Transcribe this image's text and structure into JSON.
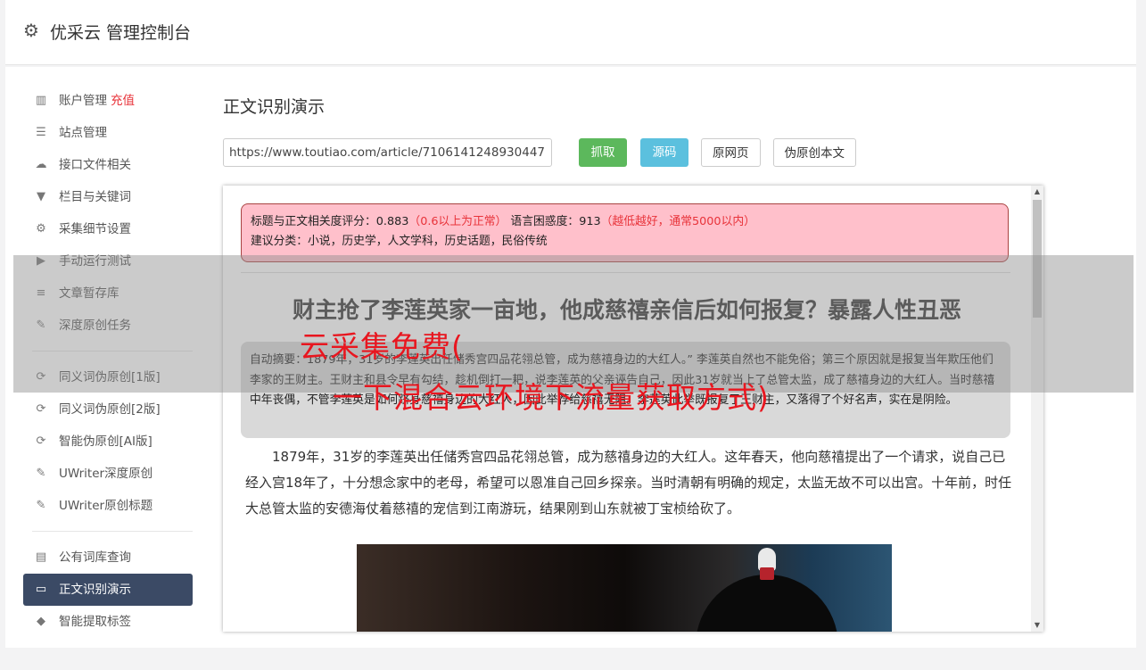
{
  "header": {
    "title": "优采云 管理控制台",
    "icon": "gear-icon"
  },
  "sidebar": {
    "group1": [
      {
        "label": "账户管理",
        "extra": "充值",
        "icon": "bar-chart-icon",
        "glyph": "▥"
      },
      {
        "label": "站点管理",
        "icon": "server-icon",
        "glyph": "☰"
      },
      {
        "label": "接口文件相关",
        "icon": "cloud-upload-icon",
        "glyph": "☁"
      },
      {
        "label": "栏目与关键词",
        "icon": "filter-icon",
        "glyph": "▼"
      },
      {
        "label": "采集细节设置",
        "icon": "cogs-icon",
        "glyph": "⚙"
      },
      {
        "label": "手动运行测试",
        "icon": "play-circle-icon",
        "glyph": "▶"
      },
      {
        "label": "文章暂存库",
        "icon": "database-icon",
        "glyph": "≡"
      },
      {
        "label": "深度原创任务",
        "icon": "edit-icon",
        "glyph": "✎"
      }
    ],
    "group2": [
      {
        "label": "同义词伪原创[1版]",
        "icon": "refresh-icon",
        "glyph": "⟳"
      },
      {
        "label": "同义词伪原创[2版]",
        "icon": "refresh-icon",
        "glyph": "⟳"
      },
      {
        "label": "智能伪原创[AI版]",
        "icon": "refresh-icon",
        "glyph": "⟳"
      },
      {
        "label": "UWriter深度原创",
        "icon": "edit-icon",
        "glyph": "✎"
      },
      {
        "label": "UWriter原创标题",
        "icon": "edit-icon",
        "glyph": "✎"
      }
    ],
    "group3": [
      {
        "label": "公有词库查询",
        "icon": "book-icon",
        "glyph": "▤"
      },
      {
        "label": "正文识别演示",
        "icon": "monitor-icon",
        "glyph": "▭",
        "active": true
      },
      {
        "label": "智能提取标签",
        "icon": "tag-icon",
        "glyph": "◆"
      },
      {
        "label": "",
        "icon": "more-icon",
        "glyph": ""
      }
    ]
  },
  "main": {
    "title": "正文识别演示",
    "url_value": "https://www.toutiao.com/article/7106141248930447",
    "buttons": {
      "fetch": "抓取",
      "source": "源码",
      "original": "原网页",
      "pseudo": "伪原创本文"
    }
  },
  "result": {
    "score_label": "标题与正文相关度评分：0.883",
    "score_note": "（0.6以上为正常）",
    "perplexity_label": " 语言困惑度：913",
    "perplexity_note": "（越低越好，通常5000以内）",
    "category": "建议分类：小说，历史学，人文学科，历史话题，民俗传统",
    "article_title": "财主抢了李莲英家一亩地，他成慈禧亲信后如何报复？暴露人性丑恶",
    "summary": "自动摘要：1879年，31岁的李莲英出任储秀宫四品花翎总管，成为慈禧身边的大红人。” 李莲英自然也不能免俗；第三个原因就是报复当年欺压他们李家的王财主。王财主和县令早有勾结，趁机倒打一耙，说李莲英的父亲诬告自己，因此31岁就当上了总管太监，成了慈禧身边的大红人。当时慈禧中年丧偶，不管李莲英是如何跻身慈禧身边的大红人，因此举荐给慈禧无阻。李莲英此举既报复了王财主，又落得了个好名声，实在是阴险。",
    "paragraph": "1879年，31岁的李莲英出任储秀宫四品花翎总管，成为慈禧身边的大红人。这年春天，他向慈禧提出了一个请求，说自己已经入宫18年了，十分想念家中的老母，希望可以恩准自己回乡探亲。当时清朝有明确的规定，太监无故不可以出宫。十年前，时任大总管太监的安德海仗着慈禧的宠信到江南游玩，结果刚到山东就被丁宝桢给砍了。"
  },
  "overlay": {
    "line1": "云采集免费(",
    "line2": "一下混合云环境下流量获取方式)"
  },
  "colors": {
    "accent_red": "#e8333a",
    "active_nav": "#3b4a65",
    "btn_green": "#5cb85c",
    "btn_blue": "#5bc0de",
    "score_bg": "#ffc0cb"
  }
}
